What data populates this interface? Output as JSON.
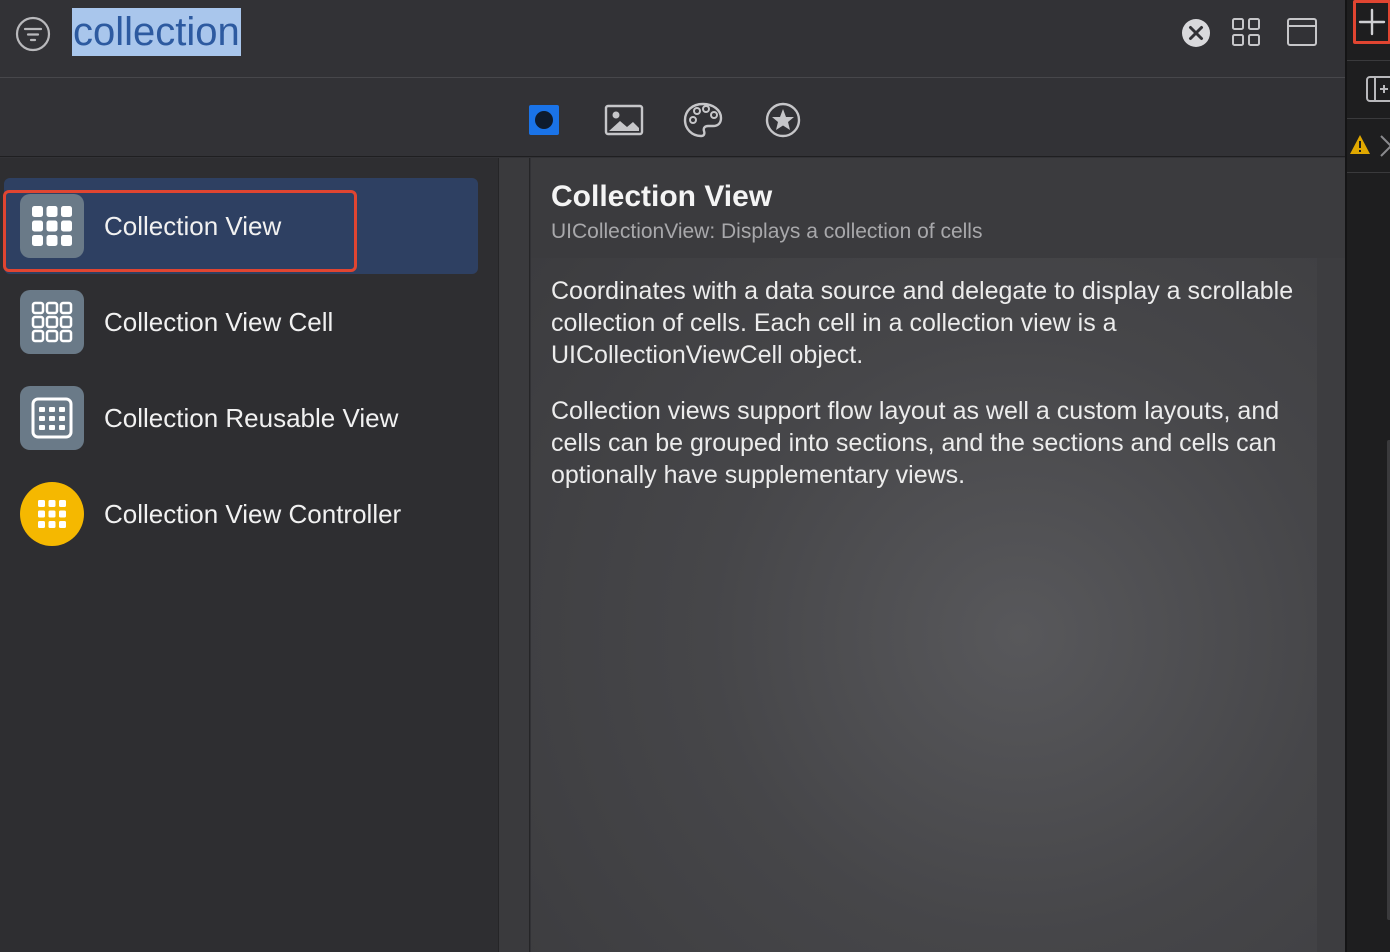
{
  "search": {
    "query": "collection"
  },
  "tabs": [
    {
      "name": "objects",
      "icon": "objects-icon",
      "selected": true
    },
    {
      "name": "media",
      "icon": "image-icon",
      "selected": false
    },
    {
      "name": "colors",
      "icon": "palette-icon",
      "selected": false
    },
    {
      "name": "favorites",
      "icon": "star-icon",
      "selected": false
    }
  ],
  "items": [
    {
      "label": "Collection View",
      "icon": "grid-icon",
      "selected": true
    },
    {
      "label": "Collection View Cell",
      "icon": "cell-grid-icon",
      "selected": false
    },
    {
      "label": "Collection Reusable View",
      "icon": "reusable-view-icon",
      "selected": false
    },
    {
      "label": "Collection View Controller",
      "icon": "controller-icon",
      "selected": false
    }
  ],
  "detail": {
    "title": "Collection View",
    "subtitle": "UICollectionView: Displays a collection of cells",
    "paragraph1": "Coordinates with a data source and delegate to display a scrollable collection of cells. Each cell in a collection view is a UICollectionViewCell object.",
    "paragraph2": "Collection views support flow layout as well a custom layouts, and cells can be grouped into sections, and the sections and cells can optionally have supplementary views."
  },
  "colors": {
    "accent": "#1a73e8",
    "highlight": "#e04531",
    "selection": "#2e4062",
    "controller_icon": "#f5b800"
  }
}
